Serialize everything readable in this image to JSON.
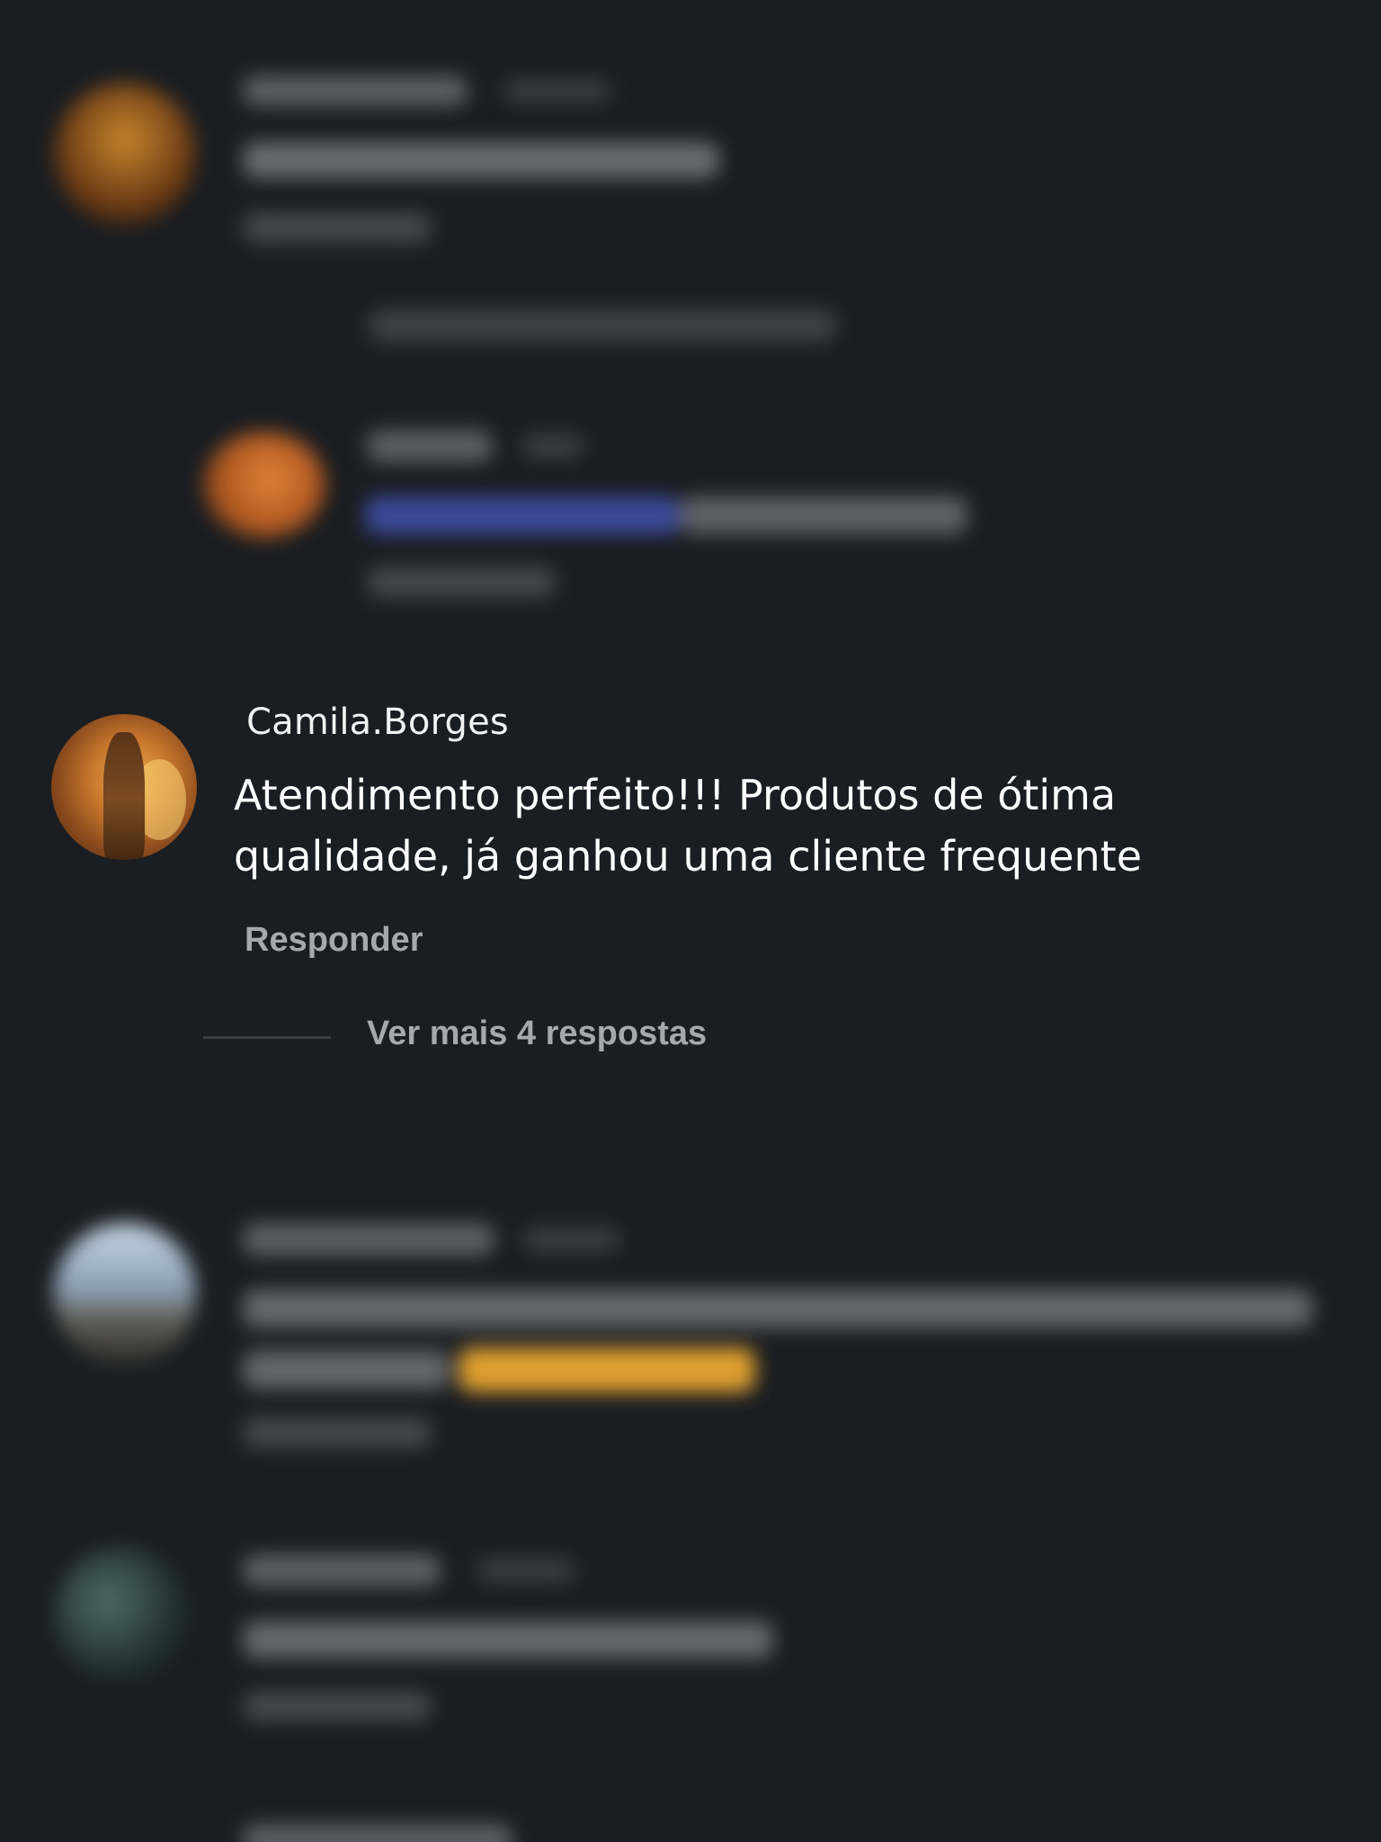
{
  "focused_comment": {
    "username": "Camila.Borges",
    "text": "Atendimento perfeito!!! Produtos de ótima qualidade, já ganhou uma cliente frequente",
    "reply_label": "Responder",
    "more_replies_label": "Ver mais 4 respostas"
  },
  "colors": {
    "background": "#1a1d21",
    "primary_text": "#ffffff",
    "secondary_text": "#a6a8ad",
    "blurred_link": "#3b4a9a",
    "blurred_emoji": "#e0a030"
  }
}
